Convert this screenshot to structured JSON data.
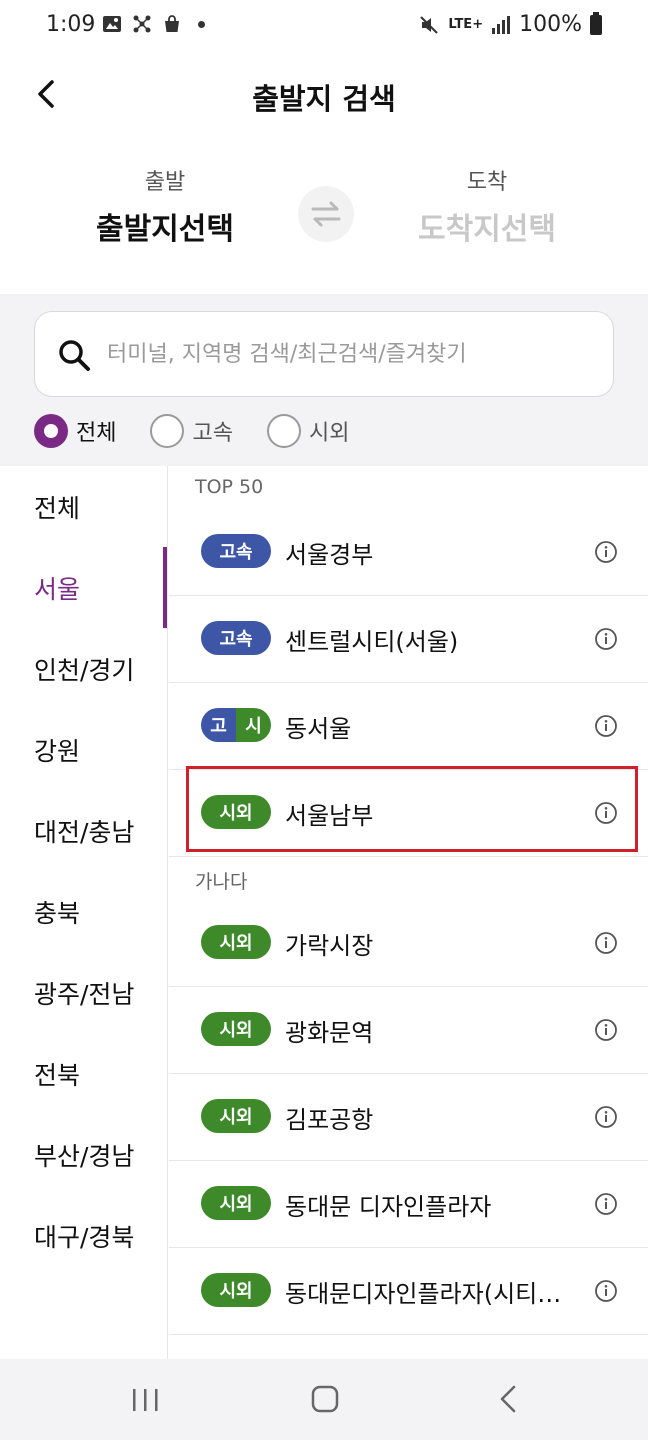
{
  "status_bar": {
    "time": "1:09",
    "network": "LTE+",
    "battery": "100%"
  },
  "header": {
    "title": "출발지 검색"
  },
  "route": {
    "departure_label": "출발",
    "departure_value": "출발지선택",
    "arrival_label": "도착",
    "arrival_value": "도착지선택"
  },
  "search": {
    "placeholder": "터미널, 지역명 검색/최근검색/즐겨찾기"
  },
  "filters": [
    "전체",
    "고속",
    "시외"
  ],
  "selected_filter": "전체",
  "regions": [
    "전체",
    "서울",
    "인천/경기",
    "강원",
    "대전/충남",
    "충북",
    "광주/전남",
    "전북",
    "부산/경남",
    "대구/경북"
  ],
  "active_region": "서울",
  "sections": {
    "top": {
      "label": "TOP 50",
      "items": [
        {
          "badge": "고속",
          "name": "서울경부"
        },
        {
          "badge": "고속",
          "name": "센트럴시티(서울)"
        },
        {
          "badge_left": "고",
          "badge_right": "시",
          "name": "동서울"
        },
        {
          "badge": "시외",
          "name": "서울남부"
        }
      ]
    },
    "alpha": {
      "label": "가나다",
      "items": [
        {
          "badge": "시외",
          "name": "가락시장"
        },
        {
          "badge": "시외",
          "name": "광화문역"
        },
        {
          "badge": "시외",
          "name": "김포공항"
        },
        {
          "badge": "시외",
          "name": "동대문 디자인플라자"
        },
        {
          "badge": "시외",
          "name": "동대문디자인플라자(시티…"
        }
      ]
    }
  },
  "colors": {
    "accent": "#7a2a85",
    "express": "#3e56a6",
    "intercity": "#3e8a2b",
    "highlight": "#d0202a"
  }
}
